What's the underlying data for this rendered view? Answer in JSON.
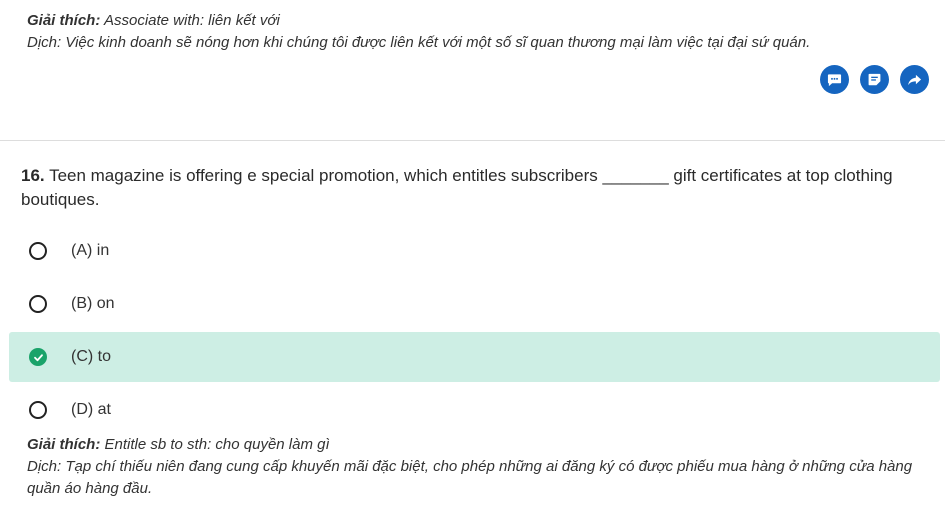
{
  "prev_explanation": {
    "term_label": "Giải thích:",
    "term_text": "Associate with: liên kết với",
    "translation": "Dịch: Việc kinh doanh sẽ nóng hơn khi chúng tôi được liên kết với một số sĩ quan thương mại làm việc tại đại sứ quán."
  },
  "actions": [
    {
      "icon": "comment-icon"
    },
    {
      "icon": "note-icon"
    },
    {
      "icon": "share-icon"
    }
  ],
  "colors": {
    "action_blue": "#1565c0",
    "correct_bg": "#cdeee4",
    "check_green": "#1aa36a"
  },
  "question": {
    "number": "16.",
    "text": "Teen magazine is offering e special promotion, which entitles subscribers _______ gift certificates at top clothing boutiques."
  },
  "options": [
    {
      "label": "(A) in",
      "correct": false
    },
    {
      "label": "(B) on",
      "correct": false
    },
    {
      "label": "(C) to",
      "correct": true
    },
    {
      "label": "(D) at",
      "correct": false
    }
  ],
  "explanation": {
    "term_label": "Giải thích:",
    "term_text": "Entitle sb to sth: cho quyền làm gì",
    "translation": "Dịch: Tạp chí thiếu niên đang cung cấp khuyến mãi đặc biệt, cho phép những ai đăng ký có được phiếu mua hàng ở những cửa hàng quần áo hàng đầu."
  }
}
